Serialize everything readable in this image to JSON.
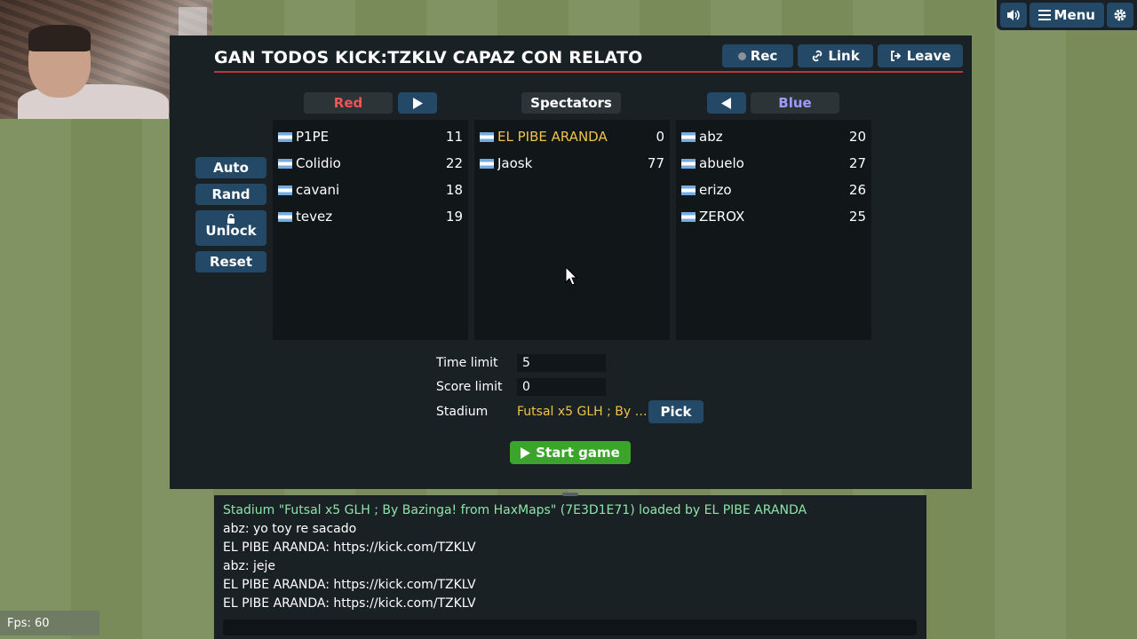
{
  "top_controls": {
    "sound_icon": "speaker-icon",
    "menu_label": "Menu",
    "settings_icon": "gear-icon"
  },
  "room": {
    "title": "GAN TODOS KICK:TZKLV CAPAZ CON RELATO",
    "rec_label": "Rec",
    "link_label": "Link",
    "leave_label": "Leave"
  },
  "side_buttons": {
    "auto": "Auto",
    "rand": "Rand",
    "unlock": "Unlock",
    "reset": "Reset"
  },
  "teams": {
    "red": {
      "label": "Red",
      "color": "#f05454",
      "players": [
        {
          "name": "P1PE",
          "score": "11"
        },
        {
          "name": "Colidio",
          "score": "22"
        },
        {
          "name": "cavani",
          "score": "18"
        },
        {
          "name": "tevez",
          "score": "19"
        }
      ]
    },
    "spectators": {
      "label": "Spectators",
      "players": [
        {
          "name": "EL PIBE ARANDA",
          "score": "0"
        },
        {
          "name": "Jaosk",
          "score": "77"
        }
      ]
    },
    "blue": {
      "label": "Blue",
      "color": "#9c9cff",
      "players": [
        {
          "name": "abz",
          "score": "20"
        },
        {
          "name": "abuelo",
          "score": "27"
        },
        {
          "name": "erizo",
          "score": "26"
        },
        {
          "name": "ZEROX",
          "score": "25"
        }
      ]
    }
  },
  "settings": {
    "time_limit_label": "Time limit",
    "time_limit_value": "5",
    "score_limit_label": "Score limit",
    "score_limit_value": "0",
    "stadium_label": "Stadium",
    "stadium_value": "Futsal x5 GLH ; By Ba...",
    "pick_label": "Pick",
    "start_label": "Start game"
  },
  "chat": {
    "lines": [
      "Stadium \"Futsal x5 GLH ; By Bazinga! from HaxMaps\" (7E3D1E71) loaded by EL PIBE ARANDA",
      "abz: yo toy re sacado",
      "EL PIBE ARANDA: https://kick.com/TZKLV",
      "abz: jeje",
      "EL PIBE ARANDA: https://kick.com/TZKLV",
      "EL PIBE ARANDA: https://kick.com/TZKLV"
    ]
  },
  "fps_label": "Fps: 60",
  "colors": {
    "button_blue": "#244967",
    "panel": "#1a2125",
    "accent_red": "#c13535",
    "start_green": "#3aa52a",
    "highlight_gold": "#f1c24a",
    "chat_notice_green": "#8fe3a8"
  }
}
